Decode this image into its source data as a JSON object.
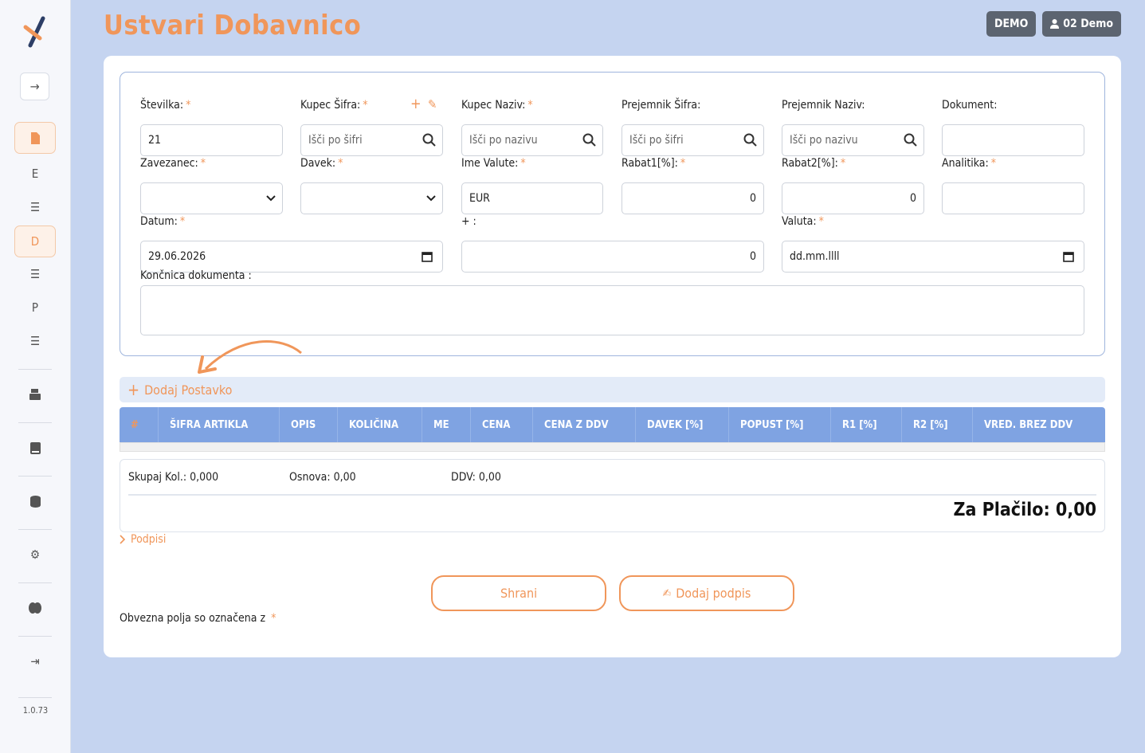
{
  "page": {
    "title": "Ustvari Dobavnico"
  },
  "topbar": {
    "demo_label": "DEMO",
    "user_label": "02 Demo"
  },
  "sidebar": {
    "letters": [
      "E",
      "D",
      "P"
    ],
    "version": "1.0.73"
  },
  "form": {
    "stevilka": {
      "label": "Številka:",
      "value": "21"
    },
    "kupec_sifra": {
      "label": "Kupec Šifra:",
      "placeholder": "Išči po šifri"
    },
    "kupec_naziv": {
      "label": "Kupec Naziv:",
      "placeholder": "Išči po nazivu"
    },
    "prejemnik_sifra": {
      "label": "Prejemnik Šifra:",
      "placeholder": "Išči po šifri"
    },
    "prejemnik_naziv": {
      "label": "Prejemnik Naziv:",
      "placeholder": "Išči po nazivu"
    },
    "dokument": {
      "label": "Dokument:",
      "value": ""
    },
    "zavezanec": {
      "label": "Zavezanec:",
      "value": ""
    },
    "davek": {
      "label": "Davek:",
      "value": ""
    },
    "ime_valute": {
      "label": "Ime Valute:",
      "value": "EUR"
    },
    "rabat1": {
      "label": "Rabat1[%]:",
      "value": "0"
    },
    "rabat2": {
      "label": "Rabat2[%]:",
      "value": "0"
    },
    "analitika": {
      "label": "Analitika:",
      "value": ""
    },
    "datum": {
      "label": "Datum:",
      "value": "29.06.2026"
    },
    "plus": {
      "label": "+ :",
      "value": "0"
    },
    "valuta": {
      "label": "Valuta:",
      "value": "dd.mm.llll"
    },
    "koncnica": {
      "label": "Končnica dokumenta :",
      "value": ""
    },
    "required_mark": "*"
  },
  "items": {
    "add_label": "Dodaj Postavko",
    "columns": [
      "#",
      "ŠIFRA ARTIKLA",
      "OPIS",
      "KOLIČINA",
      "ME",
      "CENA",
      "CENA Z DDV",
      "DAVEK [%]",
      "POPUST [%]",
      "R1 [%]",
      "R2 [%]",
      "VRED. BREZ DDV"
    ]
  },
  "totals": {
    "skupaj": "Skupaj Kol.: 0,000",
    "osnova": "Osnova: 0,00",
    "ddv": "DDV: 0,00",
    "za_placilo": "Za Plačilo: 0,00"
  },
  "podpisi_label": "Podpisi",
  "actions": {
    "save_label": "Shrani",
    "sign_label": "Dodaj podpis"
  },
  "footer_note": "Obvezna polja so označena z",
  "colors": {
    "accent": "#f0965a",
    "table_header": "#7fa3e2",
    "background": "#c5d4f0"
  }
}
